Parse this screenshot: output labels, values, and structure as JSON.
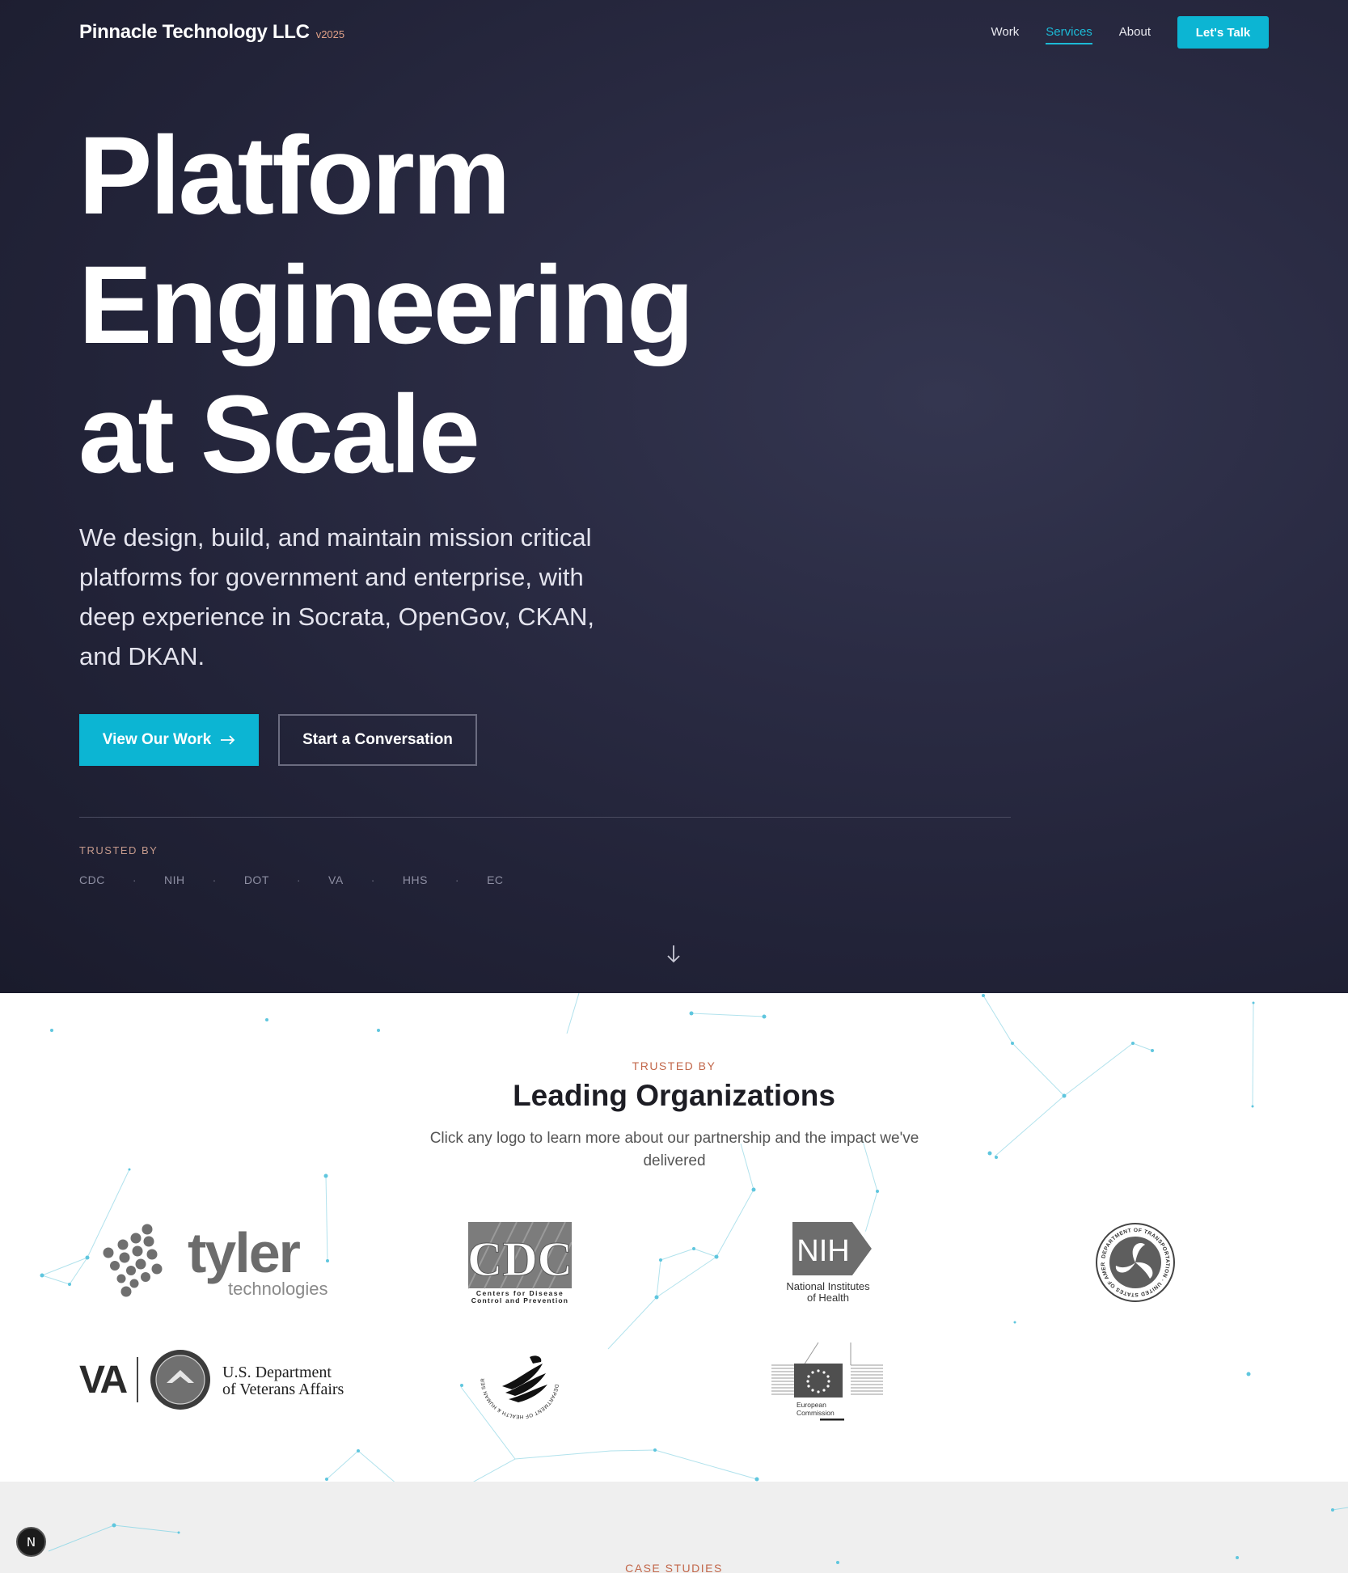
{
  "nav": {
    "brand": "Pinnacle Technology LLC",
    "version": "v2025",
    "links": [
      "Work",
      "Services",
      "About"
    ],
    "active_link": "Services",
    "cta": "Let's Talk"
  },
  "hero": {
    "title_lines": [
      "Platform",
      "Engineering",
      "at Scale"
    ],
    "subtitle": "We design, build, and maintain mission critical platforms for government and enterprise, with deep experience in Socrata, OpenGov, CKAN, and DKAN.",
    "primary_button": "View Our Work",
    "primary_button_icon": "arrow-right-icon",
    "secondary_button": "Start a Conversation",
    "trusted_label": "TRUSTED BY",
    "trusted_orgs": [
      "CDC",
      "NIH",
      "DOT",
      "VA",
      "HHS",
      "EC"
    ],
    "separator": "·",
    "scroll_icon": "arrow-down-icon"
  },
  "orgs": {
    "eyebrow": "TRUSTED BY",
    "title": "Leading Organizations",
    "subtitle": "Click any logo to learn more about our partnership and the impact we've delivered",
    "logos": {
      "tyler": {
        "word": "tyler",
        "sub": "technologies"
      },
      "cdc": {
        "word": "CDC",
        "line1": "Centers for Disease",
        "line2": "Control and Prevention"
      },
      "nih": {
        "word": "NIH",
        "line1": "National Institutes",
        "line2": "of Health"
      },
      "dot": {
        "ring": "DEPARTMENT OF TRANSPORTATION · UNITED STATES OF AMERICA"
      },
      "va": {
        "word": "VA",
        "line1": "U.S. Department",
        "line2": "of Veterans Affairs"
      },
      "hhs": {
        "ring": "DEPARTMENT OF HEALTH & HUMAN SERVICES · USA"
      },
      "ec": {
        "line1": "European",
        "line2": "Commission"
      }
    }
  },
  "cases": {
    "eyebrow": "CASE STUDIES"
  },
  "dev_badge": "N",
  "colors": {
    "accent": "#0cb5d3",
    "hero_bg": "#24253a",
    "eyebrow": "#c2674a",
    "version": "#e0a187"
  }
}
